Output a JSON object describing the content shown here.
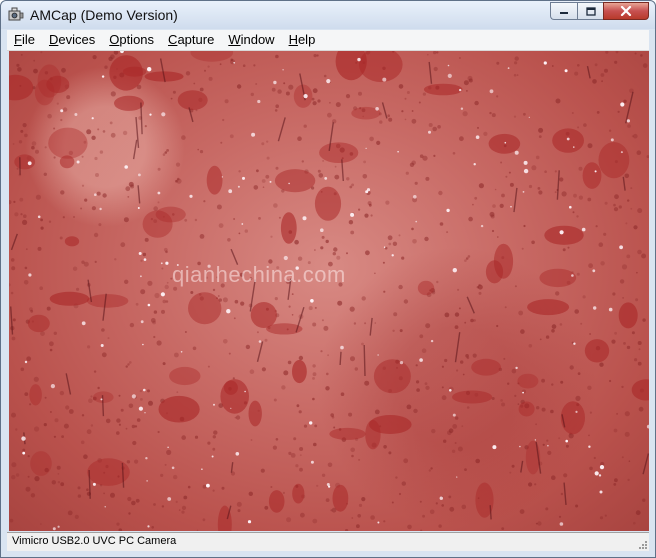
{
  "window": {
    "title": "AMCap (Demo Version)",
    "app_icon": "camera-app-icon"
  },
  "menu": {
    "items": [
      {
        "mnemonic": "F",
        "rest": "ile"
      },
      {
        "mnemonic": "D",
        "rest": "evices"
      },
      {
        "mnemonic": "O",
        "rest": "ptions"
      },
      {
        "mnemonic": "C",
        "rest": "apture"
      },
      {
        "mnemonic": "W",
        "rest": "indow"
      },
      {
        "mnemonic": "H",
        "rest": "elp"
      }
    ]
  },
  "preview": {
    "watermark": "qianhechina.com",
    "description_icon": "microscope-skin-preview"
  },
  "status": {
    "device": "Vimicro USB2.0 UVC PC Camera"
  },
  "colors": {
    "titlebar": "#cfdced",
    "close": "#c75050",
    "preview": "#c86a65"
  }
}
